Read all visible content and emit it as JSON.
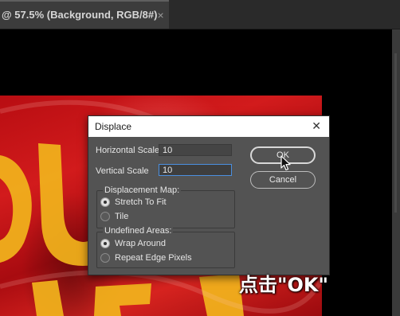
{
  "document_tab": {
    "title": "@ 57.5% (Background, RGB/8#)",
    "close_glyph": "×"
  },
  "dialog": {
    "title": "Displace",
    "close_glyph": "✕",
    "horizontal_scale": {
      "label": "Horizontal Scale",
      "value": "10"
    },
    "vertical_scale": {
      "label": "Vertical Scale",
      "value": "10"
    },
    "displacement_map": {
      "title": "Displacement Map:",
      "options": [
        {
          "label": "Stretch To Fit",
          "selected": true
        },
        {
          "label": "Tile",
          "selected": false
        }
      ]
    },
    "undefined_areas": {
      "title": "Undefined Areas:",
      "options": [
        {
          "label": "Wrap Around",
          "selected": true
        },
        {
          "label": "Repeat Edge Pixels",
          "selected": false
        }
      ]
    },
    "ok_label": "OK",
    "cancel_label": "Cancel"
  },
  "caption": "点击\"OK\"",
  "colors": {
    "flag_red": "#c8141a",
    "flag_yellow": "#f2b41c",
    "dialog_bg": "#535353",
    "focus_ring": "#4a8fe0"
  },
  "icons": [
    "close-icon",
    "mouse-pointer-icon"
  ]
}
